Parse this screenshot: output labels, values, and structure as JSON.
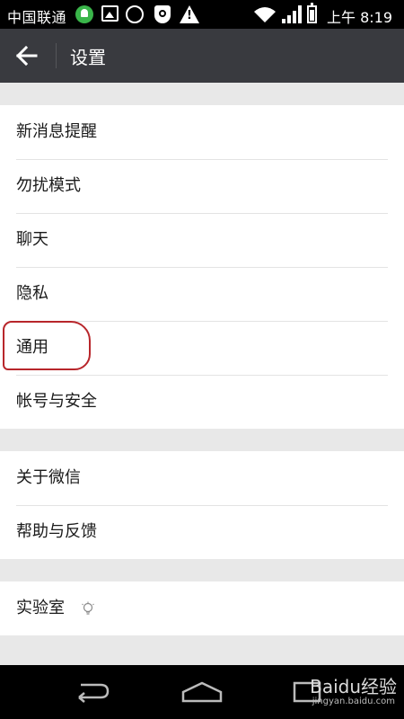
{
  "status_bar": {
    "carrier": "中国联通",
    "time": "上午 8:19",
    "icons_left": [
      "notification-bell-icon",
      "image-icon",
      "gw-icon",
      "shield-icon",
      "warning-icon"
    ],
    "icons_right": [
      "wifi-icon",
      "signal-icon",
      "battery-icon"
    ]
  },
  "header": {
    "title": "设置",
    "background": "#393a3f"
  },
  "groups": [
    {
      "items": [
        "新消息提醒",
        "勿扰模式",
        "聊天",
        "隐私",
        "通用",
        "帐号与安全"
      ]
    },
    {
      "items": [
        "关于微信",
        "帮助与反馈"
      ]
    },
    {
      "items": [
        "实验室"
      ]
    }
  ],
  "highlight": {
    "item": "通用",
    "color": "#b8262b"
  },
  "navigation": [
    "back-nav-icon",
    "home-nav-icon",
    "recent-apps-icon"
  ],
  "watermark": {
    "text": "Baidu经验",
    "sub": "jingyan.baidu.com"
  }
}
